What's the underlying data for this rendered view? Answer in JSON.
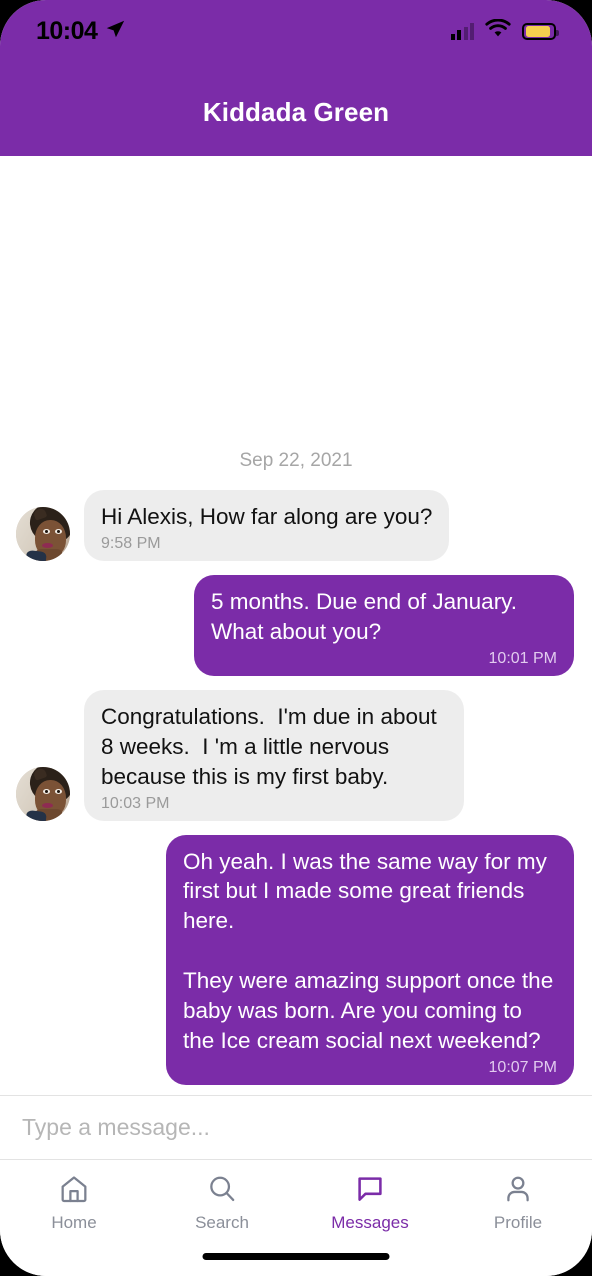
{
  "status_bar": {
    "time": "10:04",
    "location_icon": "location-arrow-icon",
    "signal_icon": "cellular-signal-icon",
    "wifi_icon": "wifi-icon",
    "battery_icon": "battery-icon",
    "battery_color": "#f5cf4f"
  },
  "header": {
    "title": "Kiddada Green",
    "background_color": "#7b2ca8"
  },
  "conversation": {
    "date_separator": "Sep 22, 2021",
    "messages": [
      {
        "direction": "incoming",
        "sender": "Kiddada Green",
        "text": "Hi Alexis, How far along are you?",
        "time": "9:58 PM",
        "has_avatar": true
      },
      {
        "direction": "outgoing",
        "sender": "Alexis",
        "text": "5 months. Due end of January. What about you?",
        "time": "10:01 PM",
        "has_avatar": false
      },
      {
        "direction": "incoming",
        "sender": "Kiddada Green",
        "text": "Congratulations.  I'm due in about 8 weeks.  I 'm a little nervous because this is my first baby.",
        "time": "10:03 PM",
        "has_avatar": true
      },
      {
        "direction": "outgoing",
        "sender": "Alexis",
        "text": "Oh yeah. I was the same way for my first but I made some great friends here.\n\nThey were amazing support once the baby was born. Are you coming to the Ice cream social next weekend?",
        "time": "10:07 PM",
        "has_avatar": false
      }
    ],
    "incoming_bubble_color": "#ededed",
    "outgoing_bubble_color": "#7b2ca8"
  },
  "composer": {
    "placeholder": "Type a message...",
    "value": ""
  },
  "tabbar": {
    "active_color": "#7b2ca8",
    "inactive_color": "#8b8f99",
    "tabs": [
      {
        "label": "Home",
        "icon": "home-icon",
        "active": false
      },
      {
        "label": "Search",
        "icon": "search-icon",
        "active": false
      },
      {
        "label": "Messages",
        "icon": "message-bubble-icon",
        "active": true
      },
      {
        "label": "Profile",
        "icon": "person-icon",
        "active": false
      }
    ]
  }
}
